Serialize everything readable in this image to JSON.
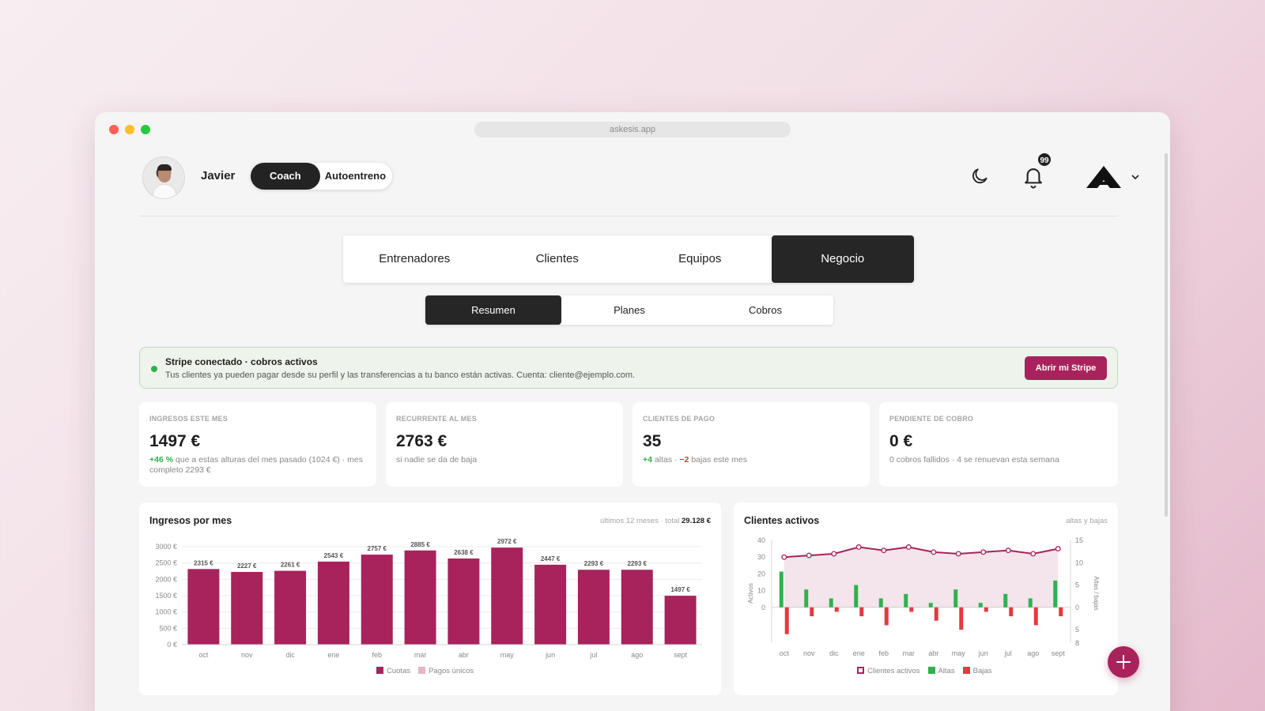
{
  "window": {
    "url": "askesis.app"
  },
  "header": {
    "user_name": "Javier",
    "mode_active": "Coach",
    "mode_inactive": "Autoentreno",
    "notification_count": "99"
  },
  "main_tabs": [
    {
      "label": "Entrenadores",
      "active": false
    },
    {
      "label": "Clientes",
      "active": false
    },
    {
      "label": "Equipos",
      "active": false
    },
    {
      "label": "Negocio",
      "active": true
    }
  ],
  "sub_tabs": [
    {
      "label": "Resumen",
      "active": true
    },
    {
      "label": "Planes",
      "active": false
    },
    {
      "label": "Cobros",
      "active": false
    }
  ],
  "stripe": {
    "title": "Stripe conectado · cobros activos",
    "description": "Tus clientes ya pueden pagar desde su perfil y las transferencias a tu banco están activas. Cuenta: cliente@ejemplo.com.",
    "button": "Abrir mi Stripe"
  },
  "stats": [
    {
      "label": "INGRESOS ESTE MES",
      "value": "1497 €",
      "note_pos": "+46 %",
      "note": " que a estas alturas del mes pasado (1024 €) · mes completo 2293 €"
    },
    {
      "label": "RECURRENTE AL MES",
      "value": "2763 €",
      "note": "si nadie se da de baja"
    },
    {
      "label": "CLIENTES DE PAGO",
      "value": "35",
      "note_pos": "+4",
      "note_mid": " altas · ",
      "note_neg": "−2",
      "note": " bajas este mes"
    },
    {
      "label": "PENDIENTE DE COBRO",
      "value": "0 €",
      "note": "0 cobros fallidos · 4 se renuevan esta semana"
    }
  ],
  "revenue_chart": {
    "title": "Ingresos por mes",
    "meta_prefix": "últimos 12 meses · total ",
    "meta_total": "29.128 €",
    "legend": [
      "Cuotas",
      "Pagos únicos"
    ]
  },
  "clients_chart": {
    "title": "Clientes activos",
    "meta": "altas y bajas",
    "left_axis_label": "Activos",
    "right_axis_label": "Altas / bajas",
    "legend": [
      "Clientes activos",
      "Altas",
      "Bajas"
    ]
  },
  "chart_data": [
    {
      "type": "bar",
      "title": "Ingresos por mes",
      "categories": [
        "oct",
        "nov",
        "dic",
        "ene",
        "feb",
        "mar",
        "abr",
        "may",
        "jun",
        "jul",
        "ago",
        "sept"
      ],
      "series": [
        {
          "name": "Cuotas",
          "values": [
            2315,
            2227,
            2261,
            2543,
            2757,
            2885,
            2638,
            2972,
            2447,
            2293,
            2293,
            1497
          ]
        },
        {
          "name": "Pagos únicos",
          "values": [
            0,
            0,
            0,
            0,
            0,
            0,
            0,
            0,
            0,
            0,
            0,
            0
          ]
        }
      ],
      "data_labels": [
        "2315 €",
        "2227 €",
        "2261 €",
        "2543 €",
        "2757 €",
        "2885 €",
        "2638 €",
        "2972 €",
        "2447 €",
        "2293 €",
        "2293 €",
        "1497 €"
      ],
      "y_ticks": [
        "3000 €",
        "2500 €",
        "2000 €",
        "1500 €",
        "1000 €",
        "500 €",
        "0 €"
      ],
      "ylim": [
        0,
        3000
      ],
      "colors": {
        "Cuotas": "#a8235b",
        "Pagos únicos": "#e7b3c6"
      },
      "grid": true,
      "legend_position": "bottom"
    },
    {
      "type": "line",
      "title": "Clientes activos",
      "categories": [
        "oct",
        "nov",
        "dic",
        "ene",
        "feb",
        "mar",
        "abr",
        "may",
        "jun",
        "jul",
        "ago",
        "sept"
      ],
      "series": [
        {
          "name": "Clientes activos",
          "axis": "left",
          "values": [
            30,
            31,
            32,
            36,
            34,
            36,
            33,
            32,
            33,
            34,
            32,
            35
          ]
        },
        {
          "name": "Altas",
          "axis": "right",
          "values": [
            8,
            4,
            2,
            5,
            2,
            3,
            1,
            4,
            1,
            3,
            2,
            6
          ]
        },
        {
          "name": "Bajas",
          "axis": "right",
          "values": [
            -6,
            -2,
            -1,
            -2,
            -4,
            -1,
            -3,
            -5,
            -1,
            -2,
            -4,
            -2
          ]
        }
      ],
      "left_ticks": [
        "40",
        "30",
        "20",
        "10",
        "0"
      ],
      "right_ticks": [
        "15",
        "10",
        "5",
        "0",
        "5",
        "8"
      ],
      "ylim_left": [
        0,
        40
      ],
      "ylim_right": [
        -8,
        15
      ],
      "colors": {
        "Clientes activos": "#a8235b",
        "Altas": "#2fb24c",
        "Bajas": "#e5393f"
      },
      "legend_position": "bottom"
    }
  ]
}
